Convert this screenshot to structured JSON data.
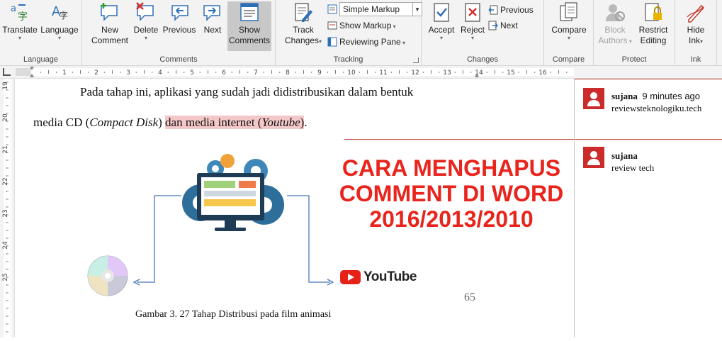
{
  "ribbon": {
    "groups": {
      "language": "Language",
      "comments": "Comments",
      "tracking": "Tracking",
      "changes": "Changes",
      "compare": "Compare",
      "protect": "Protect",
      "ink": "Ink"
    },
    "translate": "Translate",
    "language_btn": "Language",
    "new_comment_1": "New",
    "new_comment_2": "Comment",
    "delete": "Delete",
    "previous": "Previous",
    "next": "Next",
    "show_comments_1": "Show",
    "show_comments_2": "Comments",
    "track_changes_1": "Track",
    "track_changes_2": "Changes",
    "markup_select": "Simple Markup",
    "show_markup": "Show Markup",
    "reviewing_pane": "Reviewing Pane",
    "accept": "Accept",
    "reject": "Reject",
    "change_previous": "Previous",
    "change_next": "Next",
    "compare_btn": "Compare",
    "block_authors_1": "Block",
    "block_authors_2": "Authors",
    "restrict_editing_1": "Restrict",
    "restrict_editing_2": "Editing",
    "hide_ink_1": "Hide",
    "hide_ink_2": "Ink"
  },
  "ruler": {
    "h_numbers": [
      "1",
      "2",
      "3",
      "4",
      "5",
      "6",
      "7",
      "8",
      "9",
      "10",
      "11",
      "12",
      "13",
      "14",
      "15",
      "16"
    ],
    "v_numbers": [
      "19",
      "20",
      "21",
      "22",
      "23",
      "24",
      "25"
    ]
  },
  "document": {
    "line1": "Pada tahap ini, aplikasi yang sudah jadi didistribusikan dalam bentuk",
    "line2_a": "media CD (",
    "line2_b": "Compact Disk",
    "line2_c": ") ",
    "line2_hl_a": "dan media internet (",
    "line2_hl_b": "Youtube",
    "line2_hl_c": ")",
    "line2_end": ".",
    "headline_1": "CARA MENGHAPUS",
    "headline_2": "COMMENT DI WORD",
    "headline_3": "2016/2013/2010",
    "youtube_label": "YouTube",
    "page_number": "65",
    "caption": "Gambar 3. 27 Tahap Distribusi pada film animasi"
  },
  "comments": [
    {
      "author": "sujana",
      "time": "9 minutes ago",
      "text": "reviewsteknologiku.tech"
    },
    {
      "author": "sujana",
      "time": "",
      "text": "review tech"
    }
  ],
  "colors": {
    "accent_red": "#e8241c",
    "highlight": "#f4c7c9",
    "avatar": "#cc2b2b",
    "icon_blue": "#2e6fb7"
  }
}
